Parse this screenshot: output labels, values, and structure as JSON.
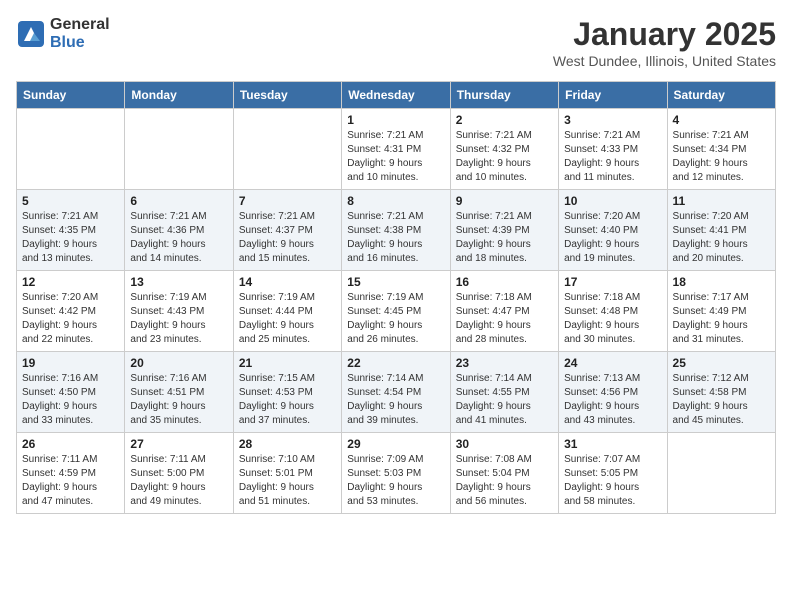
{
  "header": {
    "logo": {
      "general": "General",
      "blue": "Blue"
    },
    "title": "January 2025",
    "location": "West Dundee, Illinois, United States"
  },
  "weekdays": [
    "Sunday",
    "Monday",
    "Tuesday",
    "Wednesday",
    "Thursday",
    "Friday",
    "Saturday"
  ],
  "weeks": [
    [
      {
        "day": "",
        "info": ""
      },
      {
        "day": "",
        "info": ""
      },
      {
        "day": "",
        "info": ""
      },
      {
        "day": "1",
        "info": "Sunrise: 7:21 AM\nSunset: 4:31 PM\nDaylight: 9 hours\nand 10 minutes."
      },
      {
        "day": "2",
        "info": "Sunrise: 7:21 AM\nSunset: 4:32 PM\nDaylight: 9 hours\nand 10 minutes."
      },
      {
        "day": "3",
        "info": "Sunrise: 7:21 AM\nSunset: 4:33 PM\nDaylight: 9 hours\nand 11 minutes."
      },
      {
        "day": "4",
        "info": "Sunrise: 7:21 AM\nSunset: 4:34 PM\nDaylight: 9 hours\nand 12 minutes."
      }
    ],
    [
      {
        "day": "5",
        "info": "Sunrise: 7:21 AM\nSunset: 4:35 PM\nDaylight: 9 hours\nand 13 minutes."
      },
      {
        "day": "6",
        "info": "Sunrise: 7:21 AM\nSunset: 4:36 PM\nDaylight: 9 hours\nand 14 minutes."
      },
      {
        "day": "7",
        "info": "Sunrise: 7:21 AM\nSunset: 4:37 PM\nDaylight: 9 hours\nand 15 minutes."
      },
      {
        "day": "8",
        "info": "Sunrise: 7:21 AM\nSunset: 4:38 PM\nDaylight: 9 hours\nand 16 minutes."
      },
      {
        "day": "9",
        "info": "Sunrise: 7:21 AM\nSunset: 4:39 PM\nDaylight: 9 hours\nand 18 minutes."
      },
      {
        "day": "10",
        "info": "Sunrise: 7:20 AM\nSunset: 4:40 PM\nDaylight: 9 hours\nand 19 minutes."
      },
      {
        "day": "11",
        "info": "Sunrise: 7:20 AM\nSunset: 4:41 PM\nDaylight: 9 hours\nand 20 minutes."
      }
    ],
    [
      {
        "day": "12",
        "info": "Sunrise: 7:20 AM\nSunset: 4:42 PM\nDaylight: 9 hours\nand 22 minutes."
      },
      {
        "day": "13",
        "info": "Sunrise: 7:19 AM\nSunset: 4:43 PM\nDaylight: 9 hours\nand 23 minutes."
      },
      {
        "day": "14",
        "info": "Sunrise: 7:19 AM\nSunset: 4:44 PM\nDaylight: 9 hours\nand 25 minutes."
      },
      {
        "day": "15",
        "info": "Sunrise: 7:19 AM\nSunset: 4:45 PM\nDaylight: 9 hours\nand 26 minutes."
      },
      {
        "day": "16",
        "info": "Sunrise: 7:18 AM\nSunset: 4:47 PM\nDaylight: 9 hours\nand 28 minutes."
      },
      {
        "day": "17",
        "info": "Sunrise: 7:18 AM\nSunset: 4:48 PM\nDaylight: 9 hours\nand 30 minutes."
      },
      {
        "day": "18",
        "info": "Sunrise: 7:17 AM\nSunset: 4:49 PM\nDaylight: 9 hours\nand 31 minutes."
      }
    ],
    [
      {
        "day": "19",
        "info": "Sunrise: 7:16 AM\nSunset: 4:50 PM\nDaylight: 9 hours\nand 33 minutes."
      },
      {
        "day": "20",
        "info": "Sunrise: 7:16 AM\nSunset: 4:51 PM\nDaylight: 9 hours\nand 35 minutes."
      },
      {
        "day": "21",
        "info": "Sunrise: 7:15 AM\nSunset: 4:53 PM\nDaylight: 9 hours\nand 37 minutes."
      },
      {
        "day": "22",
        "info": "Sunrise: 7:14 AM\nSunset: 4:54 PM\nDaylight: 9 hours\nand 39 minutes."
      },
      {
        "day": "23",
        "info": "Sunrise: 7:14 AM\nSunset: 4:55 PM\nDaylight: 9 hours\nand 41 minutes."
      },
      {
        "day": "24",
        "info": "Sunrise: 7:13 AM\nSunset: 4:56 PM\nDaylight: 9 hours\nand 43 minutes."
      },
      {
        "day": "25",
        "info": "Sunrise: 7:12 AM\nSunset: 4:58 PM\nDaylight: 9 hours\nand 45 minutes."
      }
    ],
    [
      {
        "day": "26",
        "info": "Sunrise: 7:11 AM\nSunset: 4:59 PM\nDaylight: 9 hours\nand 47 minutes."
      },
      {
        "day": "27",
        "info": "Sunrise: 7:11 AM\nSunset: 5:00 PM\nDaylight: 9 hours\nand 49 minutes."
      },
      {
        "day": "28",
        "info": "Sunrise: 7:10 AM\nSunset: 5:01 PM\nDaylight: 9 hours\nand 51 minutes."
      },
      {
        "day": "29",
        "info": "Sunrise: 7:09 AM\nSunset: 5:03 PM\nDaylight: 9 hours\nand 53 minutes."
      },
      {
        "day": "30",
        "info": "Sunrise: 7:08 AM\nSunset: 5:04 PM\nDaylight: 9 hours\nand 56 minutes."
      },
      {
        "day": "31",
        "info": "Sunrise: 7:07 AM\nSunset: 5:05 PM\nDaylight: 9 hours\nand 58 minutes."
      },
      {
        "day": "",
        "info": ""
      }
    ]
  ]
}
